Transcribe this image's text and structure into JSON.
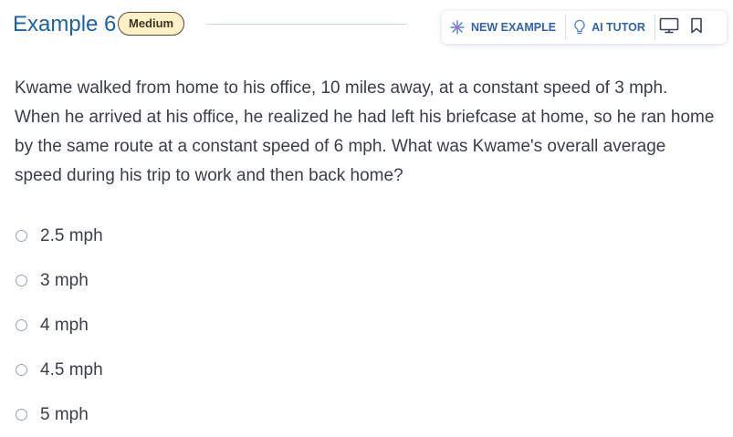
{
  "header": {
    "title": "Example 6",
    "difficulty": "Medium",
    "new_example_label": "NEW EXAMPLE",
    "ai_tutor_label": "AI TUTOR"
  },
  "question": {
    "text": "Kwame walked from home to his office, 10 miles away, at a constant speed of 3 mph. When he arrived at his office, he realized he had left his briefcase at home, so he ran home by the same route at a constant speed of 6 mph. What was Kwame's overall average speed during his trip to work and then back home?"
  },
  "options": [
    {
      "label": "2.5 mph"
    },
    {
      "label": "3 mph"
    },
    {
      "label": "4 mph"
    },
    {
      "label": "4.5 mph"
    },
    {
      "label": "5 mph"
    }
  ],
  "colors": {
    "title": "#1a63a8",
    "badge_bg": "#fff1c7",
    "action_text": "#2f62b8",
    "body_text": "#3a3f47"
  },
  "icons": {
    "new_example": "sparkle-icon",
    "ai_tutor": "lightbulb-icon",
    "monitor": "monitor-icon",
    "bookmark": "bookmark-icon"
  }
}
